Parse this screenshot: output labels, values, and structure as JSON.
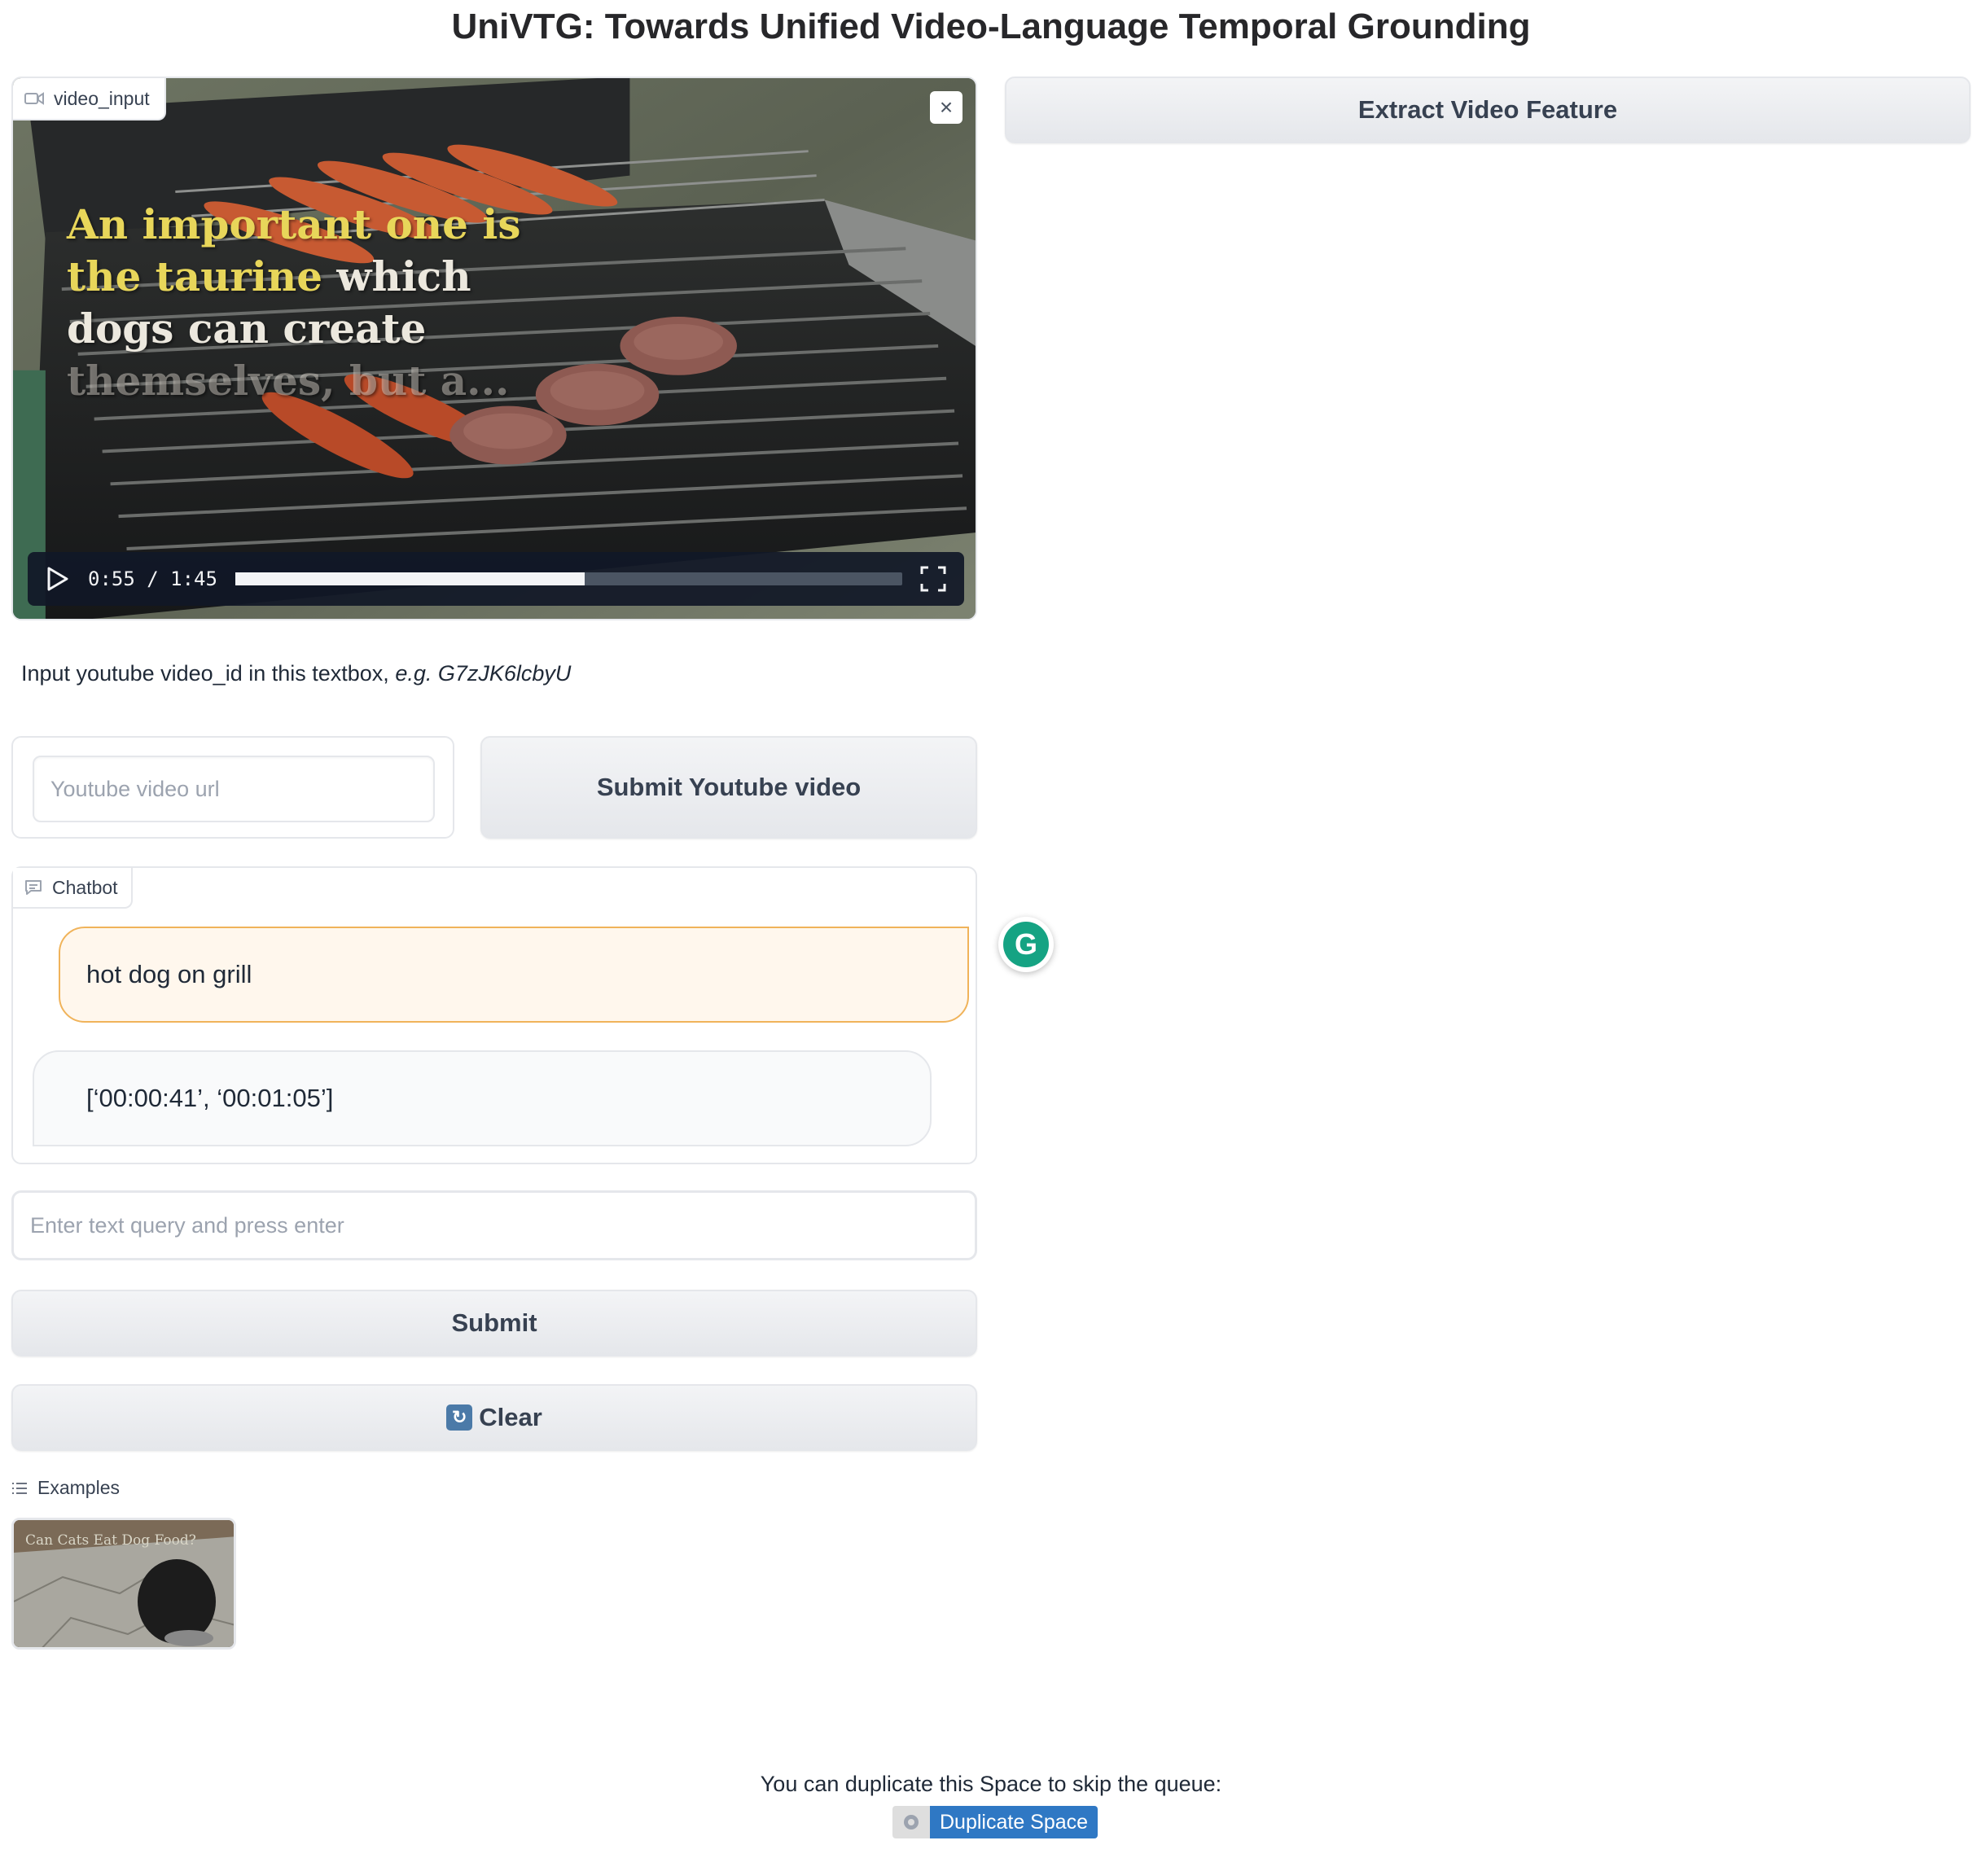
{
  "page": {
    "title": "UniVTG: Towards Unified Video-Language Temporal Grounding"
  },
  "video": {
    "label": "video_input",
    "caption_line1_yellow": "An important one is",
    "caption_line2_yellow": "the taurine",
    "caption_line2_white": " which",
    "caption_line3": "dogs can create",
    "caption_line4": "themselves, but a...",
    "time_display": "0:55 / 1:45",
    "progress_fraction": 0.524,
    "icons": {
      "camera": "video-camera-icon",
      "close": "close-icon",
      "play": "play-icon",
      "fullscreen": "fullscreen-icon"
    }
  },
  "youtube": {
    "instruction_text": "Input youtube video_id in this textbox, ",
    "instruction_example": "e.g. G7zJK6lcbyU",
    "url_placeholder": "Youtube video url",
    "submit_label": "Submit Youtube video"
  },
  "extract": {
    "label": "Extract Video Feature"
  },
  "chatbot": {
    "label": "Chatbot",
    "messages": [
      {
        "role": "user",
        "text": "hot dog on grill"
      },
      {
        "role": "bot",
        "text": "[‘00:00:41’, ‘00:01:05’]"
      }
    ]
  },
  "query": {
    "placeholder": "Enter text query and press enter"
  },
  "buttons": {
    "submit": "Submit",
    "clear": "Clear"
  },
  "examples": {
    "label": "Examples",
    "thumb_caption": "Can Cats Eat Dog Food?"
  },
  "footer": {
    "text": "You can duplicate this Space to skip the queue:",
    "duplicate_label": "Duplicate Space"
  },
  "colors": {
    "user_bubble_bg": "#fff7ed",
    "user_bubble_border": "#f0b35a",
    "duplicate_button": "#2f78c4",
    "grammarly": "#15a383"
  }
}
